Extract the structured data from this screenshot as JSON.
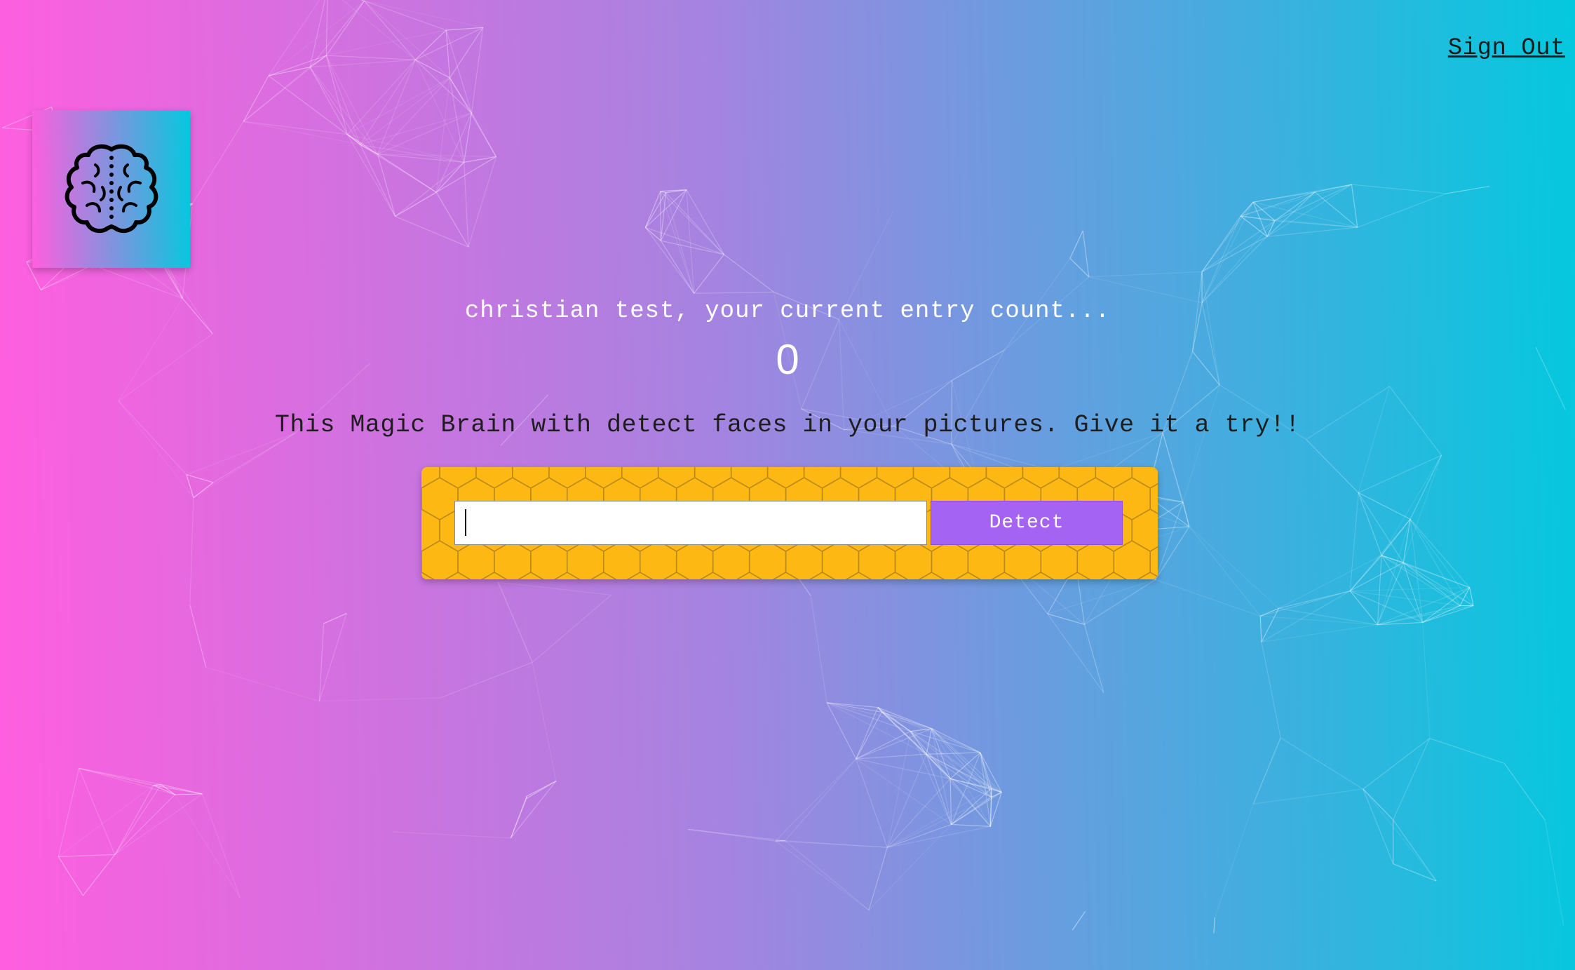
{
  "nav": {
    "sign_out_label": "Sign Out"
  },
  "logo": {
    "icon": "brain-icon"
  },
  "rank": {
    "message": "christian test, your current entry count...",
    "count": "0"
  },
  "description": "This Magic Brain with detect faces in your pictures. Give it a try!!",
  "image_form": {
    "input_value": "",
    "input_placeholder": "",
    "button_label": "Detect"
  },
  "colors": {
    "gradient_start": "#ff5edf",
    "gradient_end": "#04c8de",
    "form_background": "#fdb813",
    "button_background": "#a463f2"
  }
}
